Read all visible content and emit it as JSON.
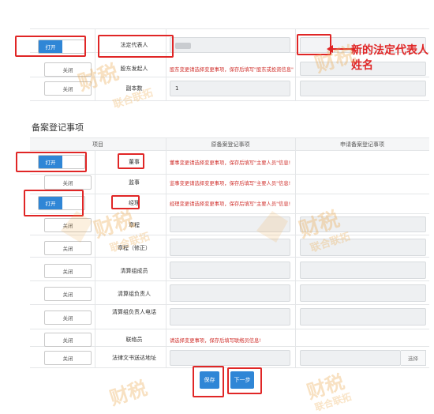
{
  "top": {
    "rows": [
      {
        "toggle": "打开",
        "label": "法定代表人",
        "value": ""
      },
      {
        "toggle": "关闭",
        "label": "股东发起人",
        "warning": "股东变更请选择变更事项，保存后填写\"股东或投资信息\""
      },
      {
        "toggle": "关闭",
        "label": "副本数",
        "value": "1"
      }
    ],
    "annotation": "新的法定代表人姓名"
  },
  "section_title": "备案登记事项",
  "table": {
    "headers": [
      "项目",
      "原备案登记事项",
      "申请备案登记事项"
    ],
    "rows": [
      {
        "toggle": "打开",
        "label": "董事",
        "warning": "董事变更请选择变更事项，保存后填写\"主要人员\"信息!"
      },
      {
        "toggle": "关闭",
        "label": "监事",
        "warning": "监事变更请选择变更事项，保存后填写\"主要人员\"信息!"
      },
      {
        "toggle": "打开",
        "label": "经理",
        "warning": "经理变更请选择变更事项，保存后填写\"主要人员\"信息!"
      },
      {
        "toggle": "关闭",
        "label": "章程"
      },
      {
        "toggle": "关闭",
        "label": "章程（修正）"
      },
      {
        "toggle": "关闭",
        "label": "清算组成员"
      },
      {
        "toggle": "关闭",
        "label": "清算组负责人"
      },
      {
        "toggle": "关闭",
        "label": "清算组负责人电话"
      },
      {
        "toggle": "关闭",
        "label": "联络员",
        "warning": "请选择变更事项，保存后填写联络员信息!"
      },
      {
        "toggle": "关闭",
        "label": "法律文书送达地址",
        "select_label": "选择"
      }
    ]
  },
  "buttons": {
    "save": "保存",
    "next": "下一步"
  },
  "watermark": {
    "main": "财税",
    "sub": "联合联拓"
  },
  "colors": {
    "accent": "#2f86d6",
    "warning": "#d0312d",
    "annotation_red": "#e02626",
    "watermark": "#eca850"
  }
}
